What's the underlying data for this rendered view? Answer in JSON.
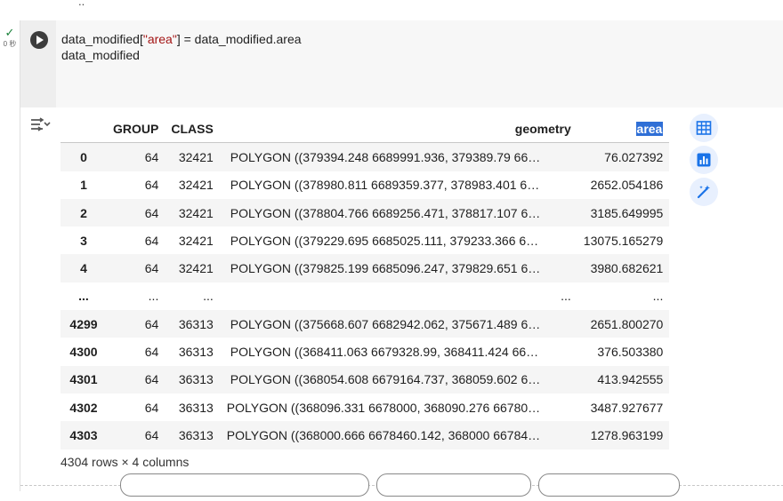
{
  "status": {
    "time": "0 秒"
  },
  "code": {
    "line1_a": "data_modified[",
    "line1_str": "\"area\"",
    "line1_b": "] = data_modified.area",
    "line2": "data_modified"
  },
  "table": {
    "columns": [
      "GROUP",
      "CLASS",
      "geometry",
      "area"
    ],
    "rows": [
      {
        "index": "0",
        "group": "64",
        "class": "32421",
        "geometry": "POLYGON ((379394.248 6689991.936, 379389.79 66…",
        "area": "76.027392"
      },
      {
        "index": "1",
        "group": "64",
        "class": "32421",
        "geometry": "POLYGON ((378980.811 6689359.377, 378983.401 6…",
        "area": "2652.054186"
      },
      {
        "index": "2",
        "group": "64",
        "class": "32421",
        "geometry": "POLYGON ((378804.766 6689256.471, 378817.107 6…",
        "area": "3185.649995"
      },
      {
        "index": "3",
        "group": "64",
        "class": "32421",
        "geometry": "POLYGON ((379229.695 6685025.111, 379233.366 6…",
        "area": "13075.165279"
      },
      {
        "index": "4",
        "group": "64",
        "class": "32421",
        "geometry": "POLYGON ((379825.199 6685096.247, 379829.651 6…",
        "area": "3980.682621"
      },
      {
        "index": "...",
        "group": "...",
        "class": "...",
        "geometry": "...",
        "area": "..."
      },
      {
        "index": "4299",
        "group": "64",
        "class": "36313",
        "geometry": "POLYGON ((375668.607 6682942.062, 375671.489 6…",
        "area": "2651.800270"
      },
      {
        "index": "4300",
        "group": "64",
        "class": "36313",
        "geometry": "POLYGON ((368411.063 6679328.99, 368411.424 66…",
        "area": "376.503380"
      },
      {
        "index": "4301",
        "group": "64",
        "class": "36313",
        "geometry": "POLYGON ((368054.608 6679164.737, 368059.602 6…",
        "area": "413.942555"
      },
      {
        "index": "4302",
        "group": "64",
        "class": "36313",
        "geometry": "POLYGON ((368096.331 6678000, 368090.276 66780…",
        "area": "3487.927677"
      },
      {
        "index": "4303",
        "group": "64",
        "class": "36313",
        "geometry": "POLYGON ((368000.666 6678460.142, 368000 66784…",
        "area": "1278.963199"
      }
    ],
    "summary": "4304 rows × 4 columns"
  },
  "icons": {
    "output_toggle": "output-settings-icon",
    "table": "table-icon",
    "chart": "bar-chart-icon",
    "magic": "magic-wand-icon"
  },
  "colors": {
    "accent": "#1a73e8",
    "highlight": "#2f6fd6"
  }
}
